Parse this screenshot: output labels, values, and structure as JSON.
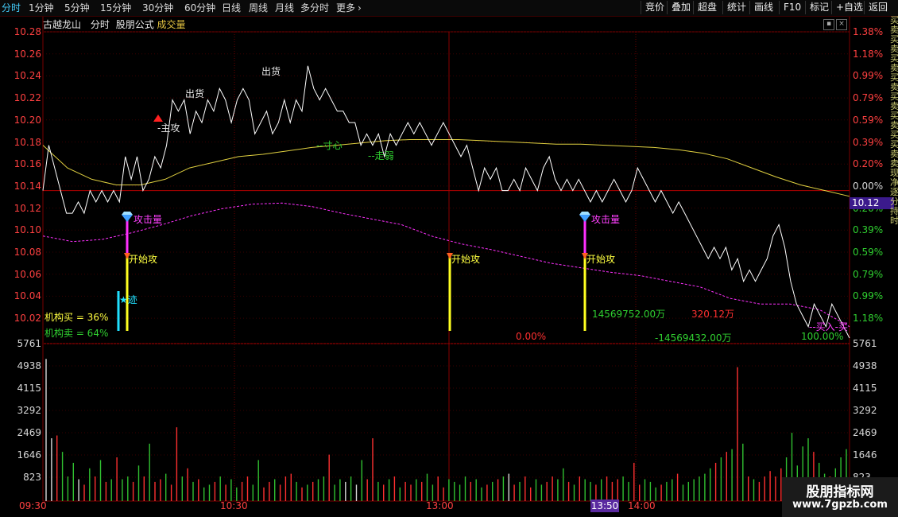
{
  "toolbar": {
    "tabs": [
      "分时",
      "1分钟",
      "5分钟",
      "15分钟",
      "30分钟",
      "60分钟",
      "日线",
      "周线",
      "月线",
      "多分时",
      "更多"
    ],
    "active_tab": "分时",
    "right_buttons": [
      "竞价",
      "叠加",
      "超盘",
      "统计",
      "画线",
      "F10",
      "标记",
      "+自选",
      "返回"
    ]
  },
  "title": {
    "stock_name": "古越龙山",
    "mode": "分时",
    "formula": "股朋公式",
    "indicator": "成交量"
  },
  "price_axis_left": [
    "10.28",
    "10.26",
    "10.24",
    "10.22",
    "10.20",
    "10.18",
    "10.16",
    "10.14",
    "10.12",
    "10.10",
    "10.08",
    "10.06",
    "10.04",
    "10.02"
  ],
  "pct_axis_right": [
    "1.38%",
    "1.18%",
    "0.99%",
    "0.79%",
    "0.59%",
    "0.39%",
    "0.20%",
    "0.00%",
    "0.20%",
    "0.39%",
    "0.59%",
    "0.79%",
    "0.99%",
    "1.18%"
  ],
  "volume_axis": [
    "5761",
    "4938",
    "4115",
    "3292",
    "2469",
    "1646",
    "823"
  ],
  "current_price": "10.12",
  "time_axis": [
    "09:30",
    "10:30",
    "13:00",
    "14:00"
  ],
  "time_cursor": "13:50",
  "colors": {
    "up": "#ff3030",
    "down": "#30c030",
    "price_line": "#ffffff",
    "avg_line": "#e0d040",
    "magenta": "#ff30ff",
    "yellow": "#ffff20",
    "cyan": "#20e0ff"
  },
  "chart_data": {
    "type": "line",
    "title": "古越龙山 分时",
    "base_price": 10.14,
    "ylim": [
      10.01,
      10.28
    ],
    "series": [
      {
        "name": "price",
        "values": [
          10.14,
          10.18,
          10.16,
          10.14,
          10.12,
          10.12,
          10.13,
          10.12,
          10.14,
          10.13,
          10.14,
          10.13,
          10.14,
          10.13,
          10.17,
          10.15,
          10.17,
          10.14,
          10.15,
          10.17,
          10.16,
          10.18,
          10.22,
          10.21,
          10.22,
          10.19,
          10.21,
          10.2,
          10.22,
          10.21,
          10.23,
          10.22,
          10.2,
          10.22,
          10.23,
          10.22,
          10.19,
          10.2,
          10.21,
          10.19,
          10.2,
          10.22,
          10.2,
          10.22,
          10.21,
          10.25,
          10.23,
          10.22,
          10.23,
          10.22,
          10.21,
          10.21,
          10.2,
          10.2,
          10.18,
          10.19,
          10.18,
          10.19,
          10.17,
          10.19,
          10.18,
          10.19,
          10.2,
          10.19,
          10.2,
          10.19,
          10.18,
          10.19,
          10.2,
          10.19,
          10.18,
          10.17,
          10.18,
          10.16,
          10.14,
          10.16,
          10.15,
          10.16,
          10.14,
          10.14,
          10.15,
          10.14,
          10.16,
          10.15,
          10.14,
          10.16,
          10.17,
          10.15,
          10.14,
          10.15,
          10.14,
          10.15,
          10.14,
          10.13,
          10.14,
          10.13,
          10.14,
          10.15,
          10.14,
          10.13,
          10.14,
          10.16,
          10.15,
          10.14,
          10.13,
          10.14,
          10.13,
          10.12,
          10.13,
          10.12,
          10.11,
          10.1,
          10.09,
          10.08,
          10.09,
          10.08,
          10.09,
          10.07,
          10.08,
          10.06,
          10.07,
          10.06,
          10.07,
          10.08,
          10.1,
          10.11,
          10.09,
          10.06,
          10.04,
          10.03,
          10.02,
          10.04,
          10.03,
          10.02,
          10.04,
          10.03,
          10.02,
          10.01
        ]
      },
      {
        "name": "avg",
        "values": [
          10.18,
          10.16,
          10.15,
          10.145,
          10.145,
          10.15,
          10.16,
          10.165,
          10.17,
          10.172,
          10.175,
          10.178,
          10.18,
          10.182,
          10.184,
          10.185,
          10.185,
          10.185,
          10.184,
          10.183,
          10.182,
          10.181,
          10.181,
          10.18,
          10.179,
          10.178,
          10.176,
          10.173,
          10.168,
          10.16,
          10.152,
          10.145,
          10.14,
          10.135
        ]
      },
      {
        "name": "lower",
        "values": [
          10.1,
          10.095,
          10.097,
          10.103,
          10.11,
          10.118,
          10.124,
          10.128,
          10.129,
          10.126,
          10.12,
          10.115,
          10.11,
          10.1,
          10.093,
          10.088,
          10.082,
          10.076,
          10.072,
          10.068,
          10.065,
          10.06,
          10.055,
          10.045,
          10.04,
          10.04,
          10.035,
          10.02
        ]
      }
    ],
    "volume_max": 5761,
    "volume_values": [
      5200,
      2300,
      2400,
      1800,
      900,
      1400,
      800,
      600,
      1200,
      900,
      1500,
      700,
      800,
      1600,
      800,
      900,
      700,
      1300,
      900,
      2100,
      700,
      800,
      1000,
      600,
      2700,
      900,
      1200,
      700,
      800,
      500,
      600,
      700,
      900,
      600,
      800,
      500,
      700,
      900,
      600,
      1500,
      500,
      700,
      800,
      600,
      900,
      1000,
      700,
      500,
      600,
      700,
      800,
      900,
      1700,
      600,
      800,
      700,
      900,
      600,
      1500,
      800,
      2300,
      700,
      600,
      800,
      900,
      500,
      700,
      600,
      800,
      700,
      1000,
      600,
      900,
      500,
      800,
      700,
      600,
      900,
      700,
      800,
      500,
      600,
      700,
      800,
      900,
      1000,
      600,
      700,
      900,
      500,
      800,
      600,
      700,
      900,
      800,
      1200,
      700,
      600,
      900,
      800,
      700,
      600,
      800,
      900,
      700,
      800,
      900,
      700,
      1400,
      600,
      800,
      700,
      500,
      600,
      700,
      800,
      1000,
      600,
      700,
      800,
      900,
      1000,
      1200,
      1400,
      1600,
      1800,
      1900,
      4900,
      2100,
      900,
      800,
      700,
      900,
      1100,
      900,
      1200,
      1600,
      2500,
      1300,
      2000,
      2300,
      1800,
      1400,
      1000,
      900,
      1200,
      1600,
      1900
    ]
  },
  "annotations": {
    "main_attack": "-主攻",
    "sell1": "出货",
    "sell2": "出货",
    "heart": "--寸心",
    "weak": "--走弱",
    "attack_vol1": "攻击量",
    "attack_vol2": "攻击量",
    "start1": "开始攻",
    "start2": "开始攻",
    "start3": "开始攻",
    "trace": "★迹",
    "inst_buy": "机构买 = 36%",
    "inst_sell": "机构卖 = 64%",
    "amt1": "14569752.00万",
    "amt2": "320.12万",
    "amt3": "-14569432.00万",
    "pct0": "0.00%",
    "pct100": "100.00%",
    "buy_sell": "--买入-买"
  },
  "watermark": {
    "line1": "股朋指标网",
    "line2": "www.7gpzb.com"
  },
  "right_strip_text": "买卖买卖买卖买卖买卖买卖买买卖卖现净逐分持时"
}
